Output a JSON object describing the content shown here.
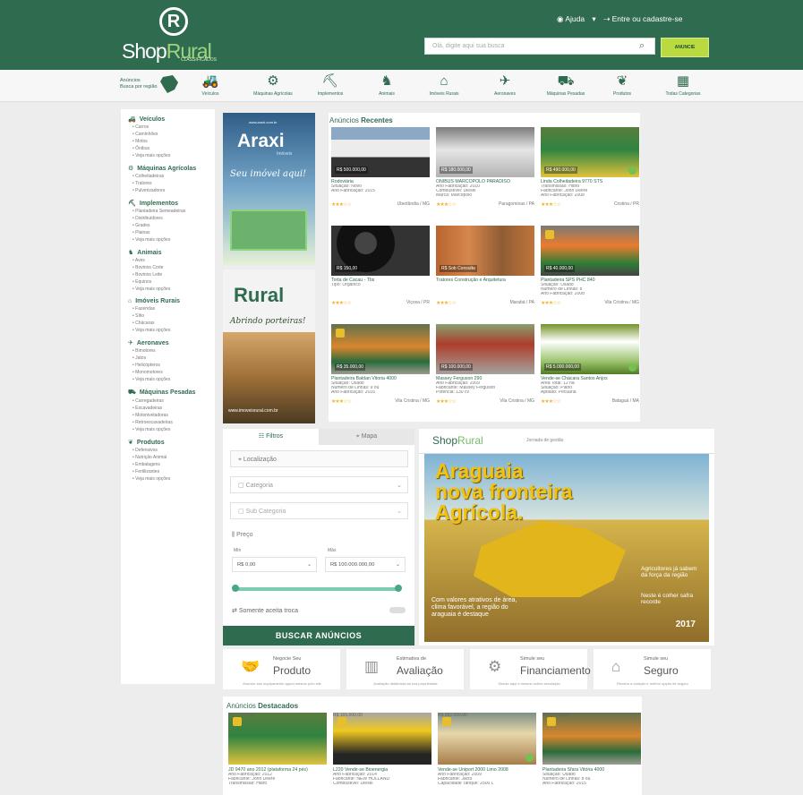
{
  "header": {
    "logo_mark": "R",
    "logo_shop": "Shop",
    "logo_rural": "Rural",
    "logo_sub": "CLASSIFICADOS",
    "help": "Ajuda",
    "auth": "Entre ou cadastre-se",
    "search_placeholder": "Olá, digite aqui sua busca",
    "announce_label": "ANUNCIE"
  },
  "categories_bar": {
    "ads_label": "Anúncios",
    "ads_subtitle": "Busca por região",
    "items": [
      {
        "label": "Veículos",
        "icon": "tractor-icon"
      },
      {
        "label": "Máquinas Agrícolas",
        "icon": "harvester-icon"
      },
      {
        "label": "Implementos",
        "icon": "implement-icon"
      },
      {
        "label": "Animais",
        "icon": "horse-icon"
      },
      {
        "label": "Imóveis Rurais",
        "icon": "barn-icon"
      },
      {
        "label": "Aeronaves",
        "icon": "plane-icon"
      },
      {
        "label": "Máquinas Pesadas",
        "icon": "excavator-icon"
      },
      {
        "label": "Produtos",
        "icon": "plant-icon"
      },
      {
        "label": "Todas Categorias",
        "icon": "grid-icon"
      }
    ]
  },
  "sidebar": [
    {
      "title": "Veículos",
      "items": [
        "Carros",
        "Caminhões",
        "Motos",
        "Ônibus",
        "Veja mais opções"
      ]
    },
    {
      "title": "Máquinas Agrícolas",
      "items": [
        "Colheitadeiras",
        "Tratores",
        "Pulverizadores"
      ]
    },
    {
      "title": "Implementos",
      "items": [
        "Plantadeira Semeadeiras",
        "Distribuidores",
        "Grades",
        "Plainas",
        "Veja mais opções"
      ]
    },
    {
      "title": "Animais",
      "items": [
        "Aves",
        "Bovinos Corte",
        "Bovinos Leite",
        "Equinos",
        "Veja mais opções"
      ]
    },
    {
      "title": "Imóveis Rurais",
      "items": [
        "Fazendas",
        "Sítio",
        "Chácaras",
        "Veja mais opções"
      ]
    },
    {
      "title": "Aeronaves",
      "items": [
        "Bimotores",
        "Jatos",
        "Helicópteros",
        "Monomotores",
        "Veja mais opções"
      ]
    },
    {
      "title": "Máquinas Pesadas",
      "items": [
        "Carregadeiras",
        "Escavadeiras",
        "Motoniveladoras",
        "Retroescavadeiras",
        "Veja mais opções"
      ]
    },
    {
      "title": "Produtos",
      "items": [
        "Defensivos",
        "Nutrição Animal",
        "Embalagens",
        "Fertilizantes",
        "Veja mais opções"
      ]
    }
  ],
  "ads": {
    "araxi_url": "www.araxi.com.br",
    "araxi": "Araxi",
    "araxi_sub": "Imóveis",
    "araxi_slogan": "Seu imóvel aqui!",
    "rural_logo": "Rural",
    "rural_slogan": "Abrindo porteiras!",
    "rural_url": "www.imoveisrural.com.br"
  },
  "recent": {
    "title_light": "Anúncios",
    "title_bold": "Recentes",
    "cards": [
      {
        "price": "R$ 500.000,00",
        "title": "Rodoviária",
        "line1": "Situação: Novo",
        "line2": "Ano Fabricação: 2015",
        "line3": "",
        "location": "Uberlândia / MG",
        "img": "truck"
      },
      {
        "price": "R$ 180.000,00",
        "title": "ÔNIBUS MARCOPOLO PARADISO",
        "line1": "Ano Fabricação: 2010",
        "line2": "Combustível: Diesel",
        "line3": "Marca: Marcopolo",
        "location": "Paragominas / PA",
        "img": "bus"
      },
      {
        "price": "R$ 490.000,00",
        "title": "Linda Colheitadeira 9770 STS",
        "line1": "Transmissão: Hidro",
        "line2": "Fabricante: John Deere",
        "line3": "Ano Fabricação: 2008",
        "location": "Cristina / PR",
        "img": "green"
      },
      {
        "price": "R$ 150,00",
        "title": "Torta de Cacau - Tbs",
        "line1": "Tipo: Orgânico",
        "line2": "",
        "line3": "",
        "location": "Viçosa / PR",
        "img": "black"
      },
      {
        "price": "R$ Sob Consulta",
        "title": "Tratores Construção e Arquitetura",
        "line1": "",
        "line2": "",
        "line3": "",
        "location": "Marabá / PA",
        "img": "industrial"
      },
      {
        "price": "R$ 40.000,00",
        "title": "Plantadeira SPS PHC 840",
        "line1": "Situação: Usado",
        "line2": "Número de Linhas: 8",
        "line3": "Ano Fabricação: 2008",
        "location": "Vila Cristina / MG",
        "img": "planter"
      },
      {
        "price": "R$ 35.000,00",
        "title": "Plantadeira Baldan Vitoria 4000",
        "line1": "Situação: Usado",
        "line2": "Número de Linhas: 9 ou",
        "line3": "Ano Fabricação: 2016",
        "location": "Vila Cristina / MG",
        "img": "orange"
      },
      {
        "price": "R$ 100.000,00",
        "title": "Massey Ferguson 290",
        "line1": "Ano Fabricação: 2009",
        "line2": "Fabricante: Massey Ferguson",
        "line3": "Potência: 130 cv",
        "location": "Vila Cristina / MG",
        "img": "tractor"
      },
      {
        "price": "R$ 5.000.000,00",
        "title": "Vende-se Chácara Santos Anjos",
        "line1": "Área Total: 12 ha",
        "line2": "Situação: Plano",
        "line3": "Aptidão: Pecuária",
        "location": "Bataguá / MA",
        "img": "farm"
      }
    ]
  },
  "filters": {
    "tab_filters": "Filtros",
    "tab_map": "Mapa",
    "location": "Localização",
    "category": "Categoria",
    "subcategory": "Sub Categoria",
    "price": "Preço",
    "min_label": "Mín",
    "max_label": "Máx",
    "min_value": "R$ 0,00",
    "max_value": "R$ 100.000.000,00",
    "trade": "Somente aceita troca",
    "submit": "BUSCAR ANÚNCIOS"
  },
  "banner": {
    "logo_shop": "Shop",
    "logo_rural": "Rural",
    "subtitle": "Jornada de gestão",
    "title_line1": "Araguaia",
    "title_line2": "nova fronteira",
    "title_line3": "Agrícola.",
    "desc": "Com valores atrativos de área, clima favorável, a região do araguaia é destaque",
    "right_text": "Agricultores já sabem da força da região",
    "harvest": "Neste é colher safra recorde",
    "year": "2017"
  },
  "services": [
    {
      "small": "Negocie Seu",
      "big": "Produto",
      "note": "Anuncie seu equipamento agora mesmo pelo site"
    },
    {
      "small": "Estimativa de",
      "big": "Avaliação",
      "note": "Avaliação detalhada da sua propriedade"
    },
    {
      "small": "Simule seu",
      "big": "Financiamento",
      "note": "Simule aqui e mesmo online simulação"
    },
    {
      "small": "Simule seu",
      "big": "Seguro",
      "note": "Receba a cotação e melhor opção de seguro"
    }
  ],
  "featured": {
    "title_light": "Anúncios",
    "title_bold": "Destacados",
    "cards": [
      {
        "price": "R$ 80.000,00",
        "title": "JD 9470 ano 2012 (plataforma 24 pés)",
        "line1": "Ano Fabricação: 2012",
        "line2": "Fabricante: John Deere",
        "line3": "Transmissão: Hidro",
        "img": "green"
      },
      {
        "price": "R$ 165.000,00",
        "title": "L220 Vende-se Bioenergia",
        "line1": "Ano Fabricação: 2014",
        "line2": "Fabricante: NEW HOLLAND",
        "line3": "Combustível: Diesel",
        "img": "yellow"
      },
      {
        "price": "R$ 282.000,00",
        "title": "Vende-se Uniport 2000 Limo 2008",
        "line1": "Ano Fabricação: 2009",
        "line2": "Fabricante: Jacto",
        "line3": "Capacidade Tanque: 2500 L",
        "img": "sand"
      },
      {
        "price": "R$ 85.000,00",
        "title": "Plantadeira Sfara Vitória 4000",
        "line1": "Situação: Usado",
        "line2": "Número de Linhas: 8 ou",
        "line3": "Ano Fabricação: 2015",
        "img": "orange"
      }
    ]
  }
}
